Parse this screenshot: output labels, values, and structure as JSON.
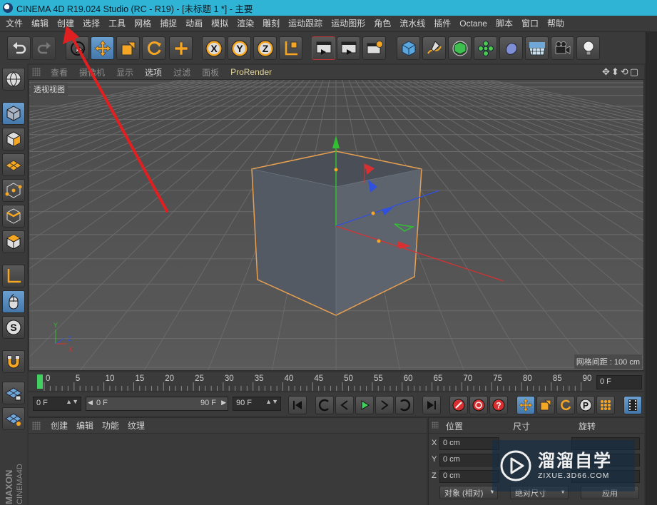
{
  "window": {
    "title": "CINEMA 4D R19.024 Studio (RC - R19) - [未标题 1 *] - 主要"
  },
  "menubar": {
    "items": [
      "文件",
      "编辑",
      "创建",
      "选择",
      "工具",
      "网格",
      "捕捉",
      "动画",
      "模拟",
      "渲染",
      "雕刻",
      "运动跟踪",
      "运动图形",
      "角色",
      "流水线",
      "插件",
      "Octane",
      "脚本",
      "窗口",
      "帮助"
    ]
  },
  "toolbar": {
    "icons": [
      "undo-icon",
      "redo-icon",
      "live-select-icon",
      "move-icon",
      "scale-icon",
      "rotate-icon",
      "add-icon",
      "x-axis-icon",
      "y-axis-icon",
      "z-axis-icon",
      "coordinate-system-icon",
      "render-view-icon",
      "render-picture-viewer-icon",
      "render-settings-icon",
      "cube-icon",
      "pen-icon",
      "subdivision-icon",
      "cloner-icon",
      "deformer-icon",
      "floor-icon",
      "camera-icon",
      "light-icon"
    ]
  },
  "viewport": {
    "menus": [
      "查看",
      "摄像机",
      "显示",
      "选项",
      "过滤",
      "面板",
      "ProRender"
    ],
    "active_menu": "选项",
    "label": "透视视图",
    "grid_note": "网格间距 : 100 cm"
  },
  "timeline": {
    "ticks": [
      "0",
      "5",
      "10",
      "15",
      "20",
      "25",
      "30",
      "35",
      "40",
      "45",
      "50",
      "55",
      "60",
      "65",
      "70",
      "75",
      "80",
      "85",
      "90"
    ],
    "current_frame": "0 F"
  },
  "transport": {
    "start": "0 F",
    "range_start": "0 F",
    "range_end": "90 F",
    "end": "90 F"
  },
  "object_panel": {
    "menus": [
      "创建",
      "编辑",
      "功能",
      "纹理"
    ]
  },
  "coordinates": {
    "headers": [
      "位置",
      "尺寸",
      "旋转"
    ],
    "axes": [
      "X",
      "Y",
      "Z"
    ],
    "position_values": [
      "0 cm",
      "0 cm",
      "0 cm"
    ],
    "mode_dropdown": "对象 (相对)",
    "size_dropdown": "绝对尺寸",
    "apply_button": "应用"
  },
  "watermark": {
    "title": "溜溜自学",
    "url": "ZIXUE.3D66.COM"
  },
  "colors": {
    "titlebar": "#2fb4d6",
    "annotation_arrow": "#e02020",
    "selection_outline": "#e8a050",
    "x_axis": "#d83030",
    "y_axis": "#30c030",
    "z_axis": "#3050e0"
  }
}
